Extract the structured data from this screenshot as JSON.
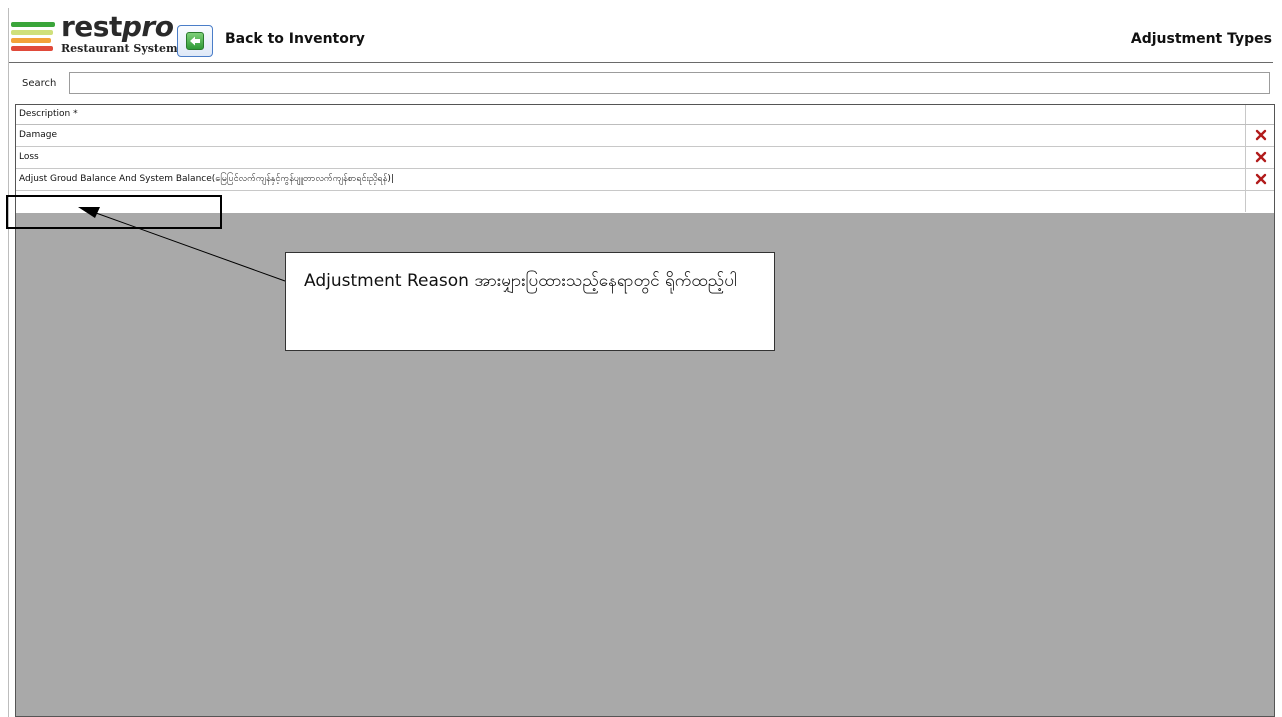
{
  "header": {
    "logo_word_a": "rest",
    "logo_word_b": "pro",
    "logo_sub": "Restaurant System",
    "back_label": "Back to Inventory",
    "page_title": "Adjustment Types"
  },
  "search": {
    "label": "Search",
    "value": "",
    "placeholder": ""
  },
  "grid": {
    "columns": [
      "Description *"
    ],
    "rows": [
      {
        "description": "Damage"
      },
      {
        "description": "Loss"
      },
      {
        "description": "Adjust Groud Balance And System Balance(မြေပြင်လက်ကျန်နှင့်ကွန်ပျူတာလက်ကျန်စာရင်းညှိရန်)|"
      }
    ],
    "new_row_value": ""
  },
  "annotation": {
    "text": "Adjustment Reason အားမျှားပြထားသည့်နေရာတွင် ရိုက်ထည့်ပါ"
  },
  "colors": {
    "delete": "#b11b1b",
    "grid_background": "#a9a9a9",
    "logo_green": "#3aa53a",
    "logo_orange": "#f2a23a",
    "logo_red": "#e04a3a"
  },
  "icons": {
    "back": "back-arrow-icon",
    "delete": "delete-x-icon"
  }
}
